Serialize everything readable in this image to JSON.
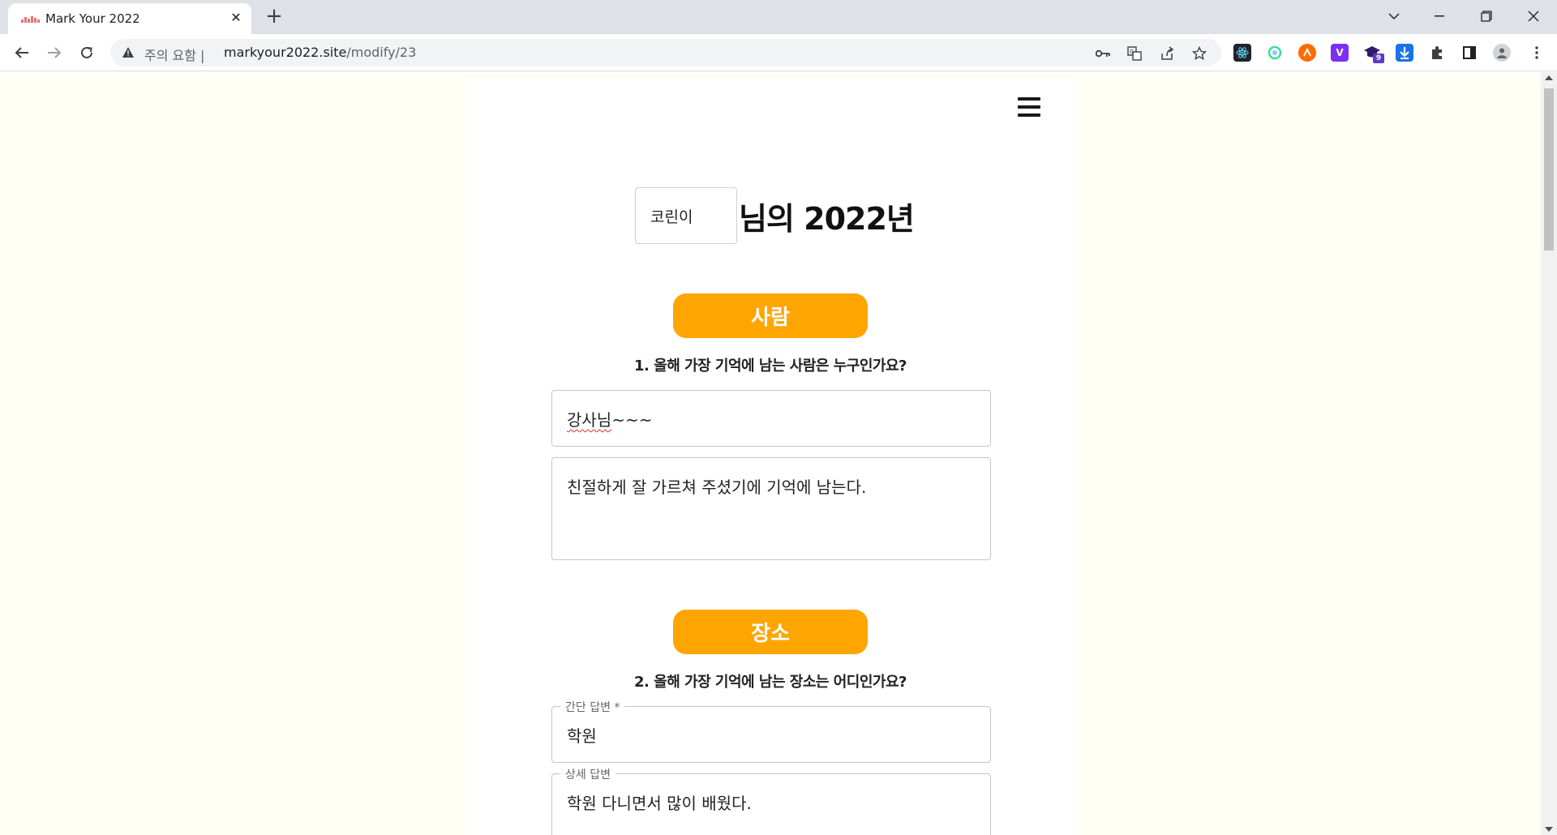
{
  "browser": {
    "tab_title": "Mark Your 2022",
    "security_label": "주의 요함",
    "url_host": "markyour2022.site",
    "url_path": "/modify/23",
    "extension_badge": "9"
  },
  "page": {
    "name_value": "코린이",
    "title_suffix": "님의 2022년",
    "sections": [
      {
        "pill": "사람",
        "question": "1. 올해 가장 기억에 남는 사람은 누구인가요?",
        "short_answer_underlined": "강사님",
        "short_answer_rest": "~~~",
        "detail_answer": "친절하게 잘 가르쳐 주셨기에 기억에 남는다."
      },
      {
        "pill": "장소",
        "question": "2. 올해 가장 기억에 남는 장소는 어디인가요?",
        "short_label": "간단 답변 *",
        "short_answer": "학원",
        "detail_label": "상세 답변",
        "detail_answer": "학원 다니면서 많이 배웠다."
      }
    ]
  },
  "colors": {
    "accent": "#ffa500",
    "page_background": "#fffef5"
  }
}
